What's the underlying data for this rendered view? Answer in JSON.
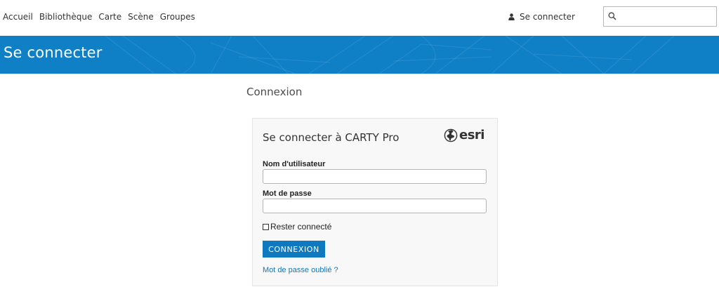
{
  "nav": {
    "items": [
      "Accueil",
      "Bibliothèque",
      "Carte",
      "Scène",
      "Groupes"
    ],
    "signin_label": "Se connecter",
    "search_value": "",
    "search_placeholder": ""
  },
  "banner": {
    "title": "Se connecter"
  },
  "page": {
    "section_title": "Connexion"
  },
  "form": {
    "title": "Se connecter à CARTY Pro",
    "logo_text": "esri",
    "username_label": "Nom d'utilisateur",
    "username_value": "",
    "password_label": "Mot de passe",
    "password_value": "",
    "remember_label": "Rester connecté",
    "remember_checked": false,
    "submit_label": "CONNEXION",
    "forgot_label": "Mot de passe oublié ?"
  },
  "colors": {
    "banner": "#0f7fc6",
    "button": "#0f79bf",
    "link": "#1a73b5",
    "card_background": "#f8f8f8"
  },
  "icons": [
    "user-icon",
    "search-icon",
    "globe-icon"
  ]
}
